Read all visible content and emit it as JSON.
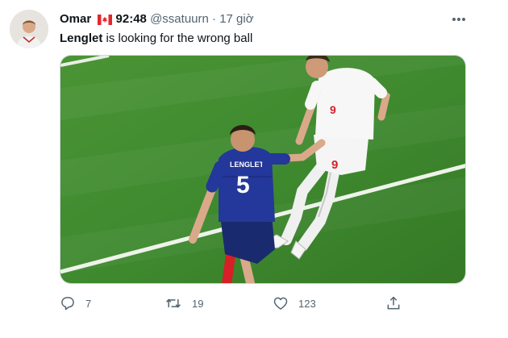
{
  "tweet": {
    "author_name": "Omar",
    "author_flag": "canada-flag",
    "author_suffix": "92:48",
    "handle": "@ssatuurn",
    "separator": "·",
    "time": "17 giờ",
    "text_bold": "Lenglet",
    "text_rest": " is looking for the wrong ball",
    "media": {
      "description_icon": "football-photo",
      "player_left_name": "LENGLET",
      "player_left_number": "5",
      "player_right_number": "9"
    },
    "actions": {
      "reply_count": "7",
      "retweet_count": "19",
      "like_count": "123"
    }
  },
  "colors": {
    "text_primary": "#0f1419",
    "text_secondary": "#536471",
    "pitch_green": "#3f8a2f",
    "france_blue": "#1e2f8c",
    "swiss_white": "#f4f4f4",
    "swiss_red": "#d61f26"
  }
}
